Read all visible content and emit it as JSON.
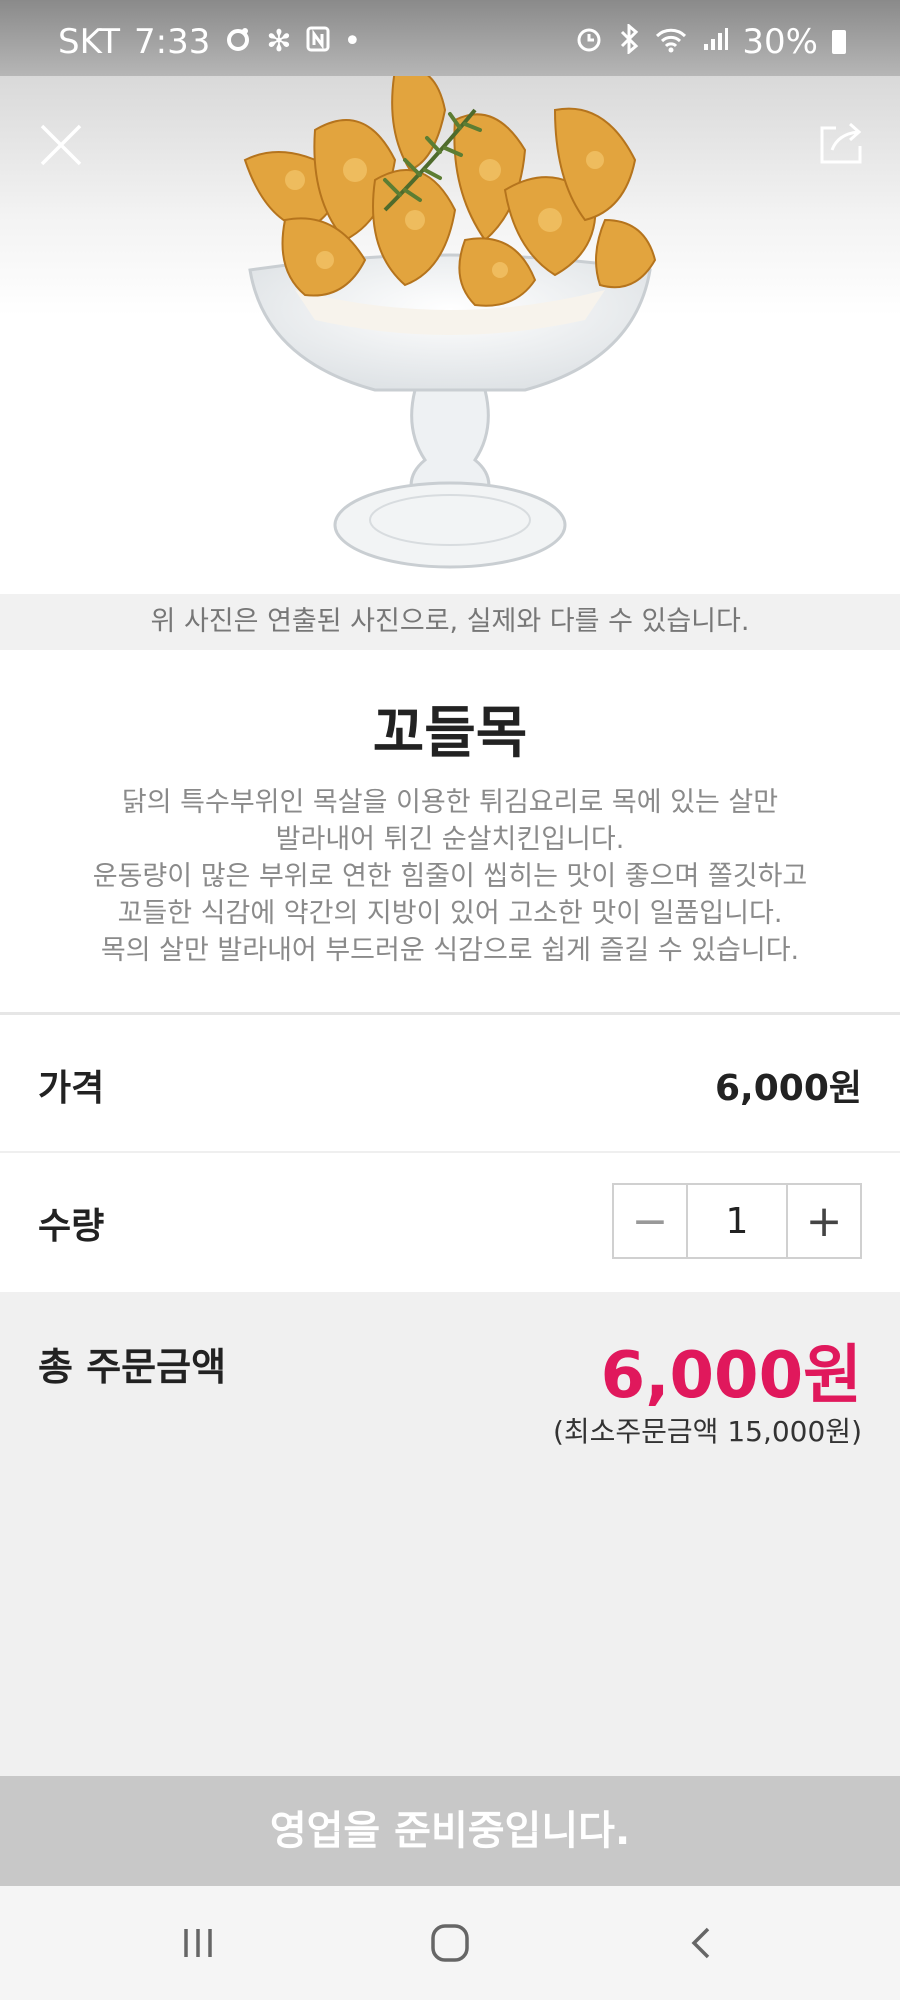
{
  "status_bar": {
    "carrier": "SKT",
    "time": "7:33",
    "battery": "30%",
    "icons_left": [
      "sync-icon",
      "fan-icon",
      "nfc-icon",
      "dot-icon"
    ],
    "icons_right": [
      "alarm-icon",
      "bluetooth-icon",
      "wifi-icon",
      "signal-icon",
      "battery-icon"
    ]
  },
  "header": {
    "close_icon": "close-icon",
    "share_icon": "share-icon"
  },
  "photo_disclaimer": "위 사진은 연출된 사진으로, 실제와 다를 수 있습니다.",
  "product": {
    "name": "꼬들목",
    "description_lines": [
      "닭의 특수부위인 목살을 이용한 튀김요리로 목에 있는 살만",
      "발라내어 튀긴 순살치킨입니다.",
      "운동량이 많은 부위로 연한 힘줄이 씹히는 맛이 좋으며 쫄깃하고",
      "꼬들한 식감에 약간의 지방이 있어 고소한 맛이 일품입니다.",
      "목의 살만 발라내어 부드러운 식감으로 쉽게 즐길 수 있습니다."
    ]
  },
  "price": {
    "label": "가격",
    "value": "6,000원"
  },
  "quantity": {
    "label": "수량",
    "value": "1",
    "minus": "−",
    "plus": "+"
  },
  "total": {
    "label": "총 주문금액",
    "value": "6,000원",
    "min_order": "(최소주문금액 15,000원)",
    "accent_color": "#e0185c"
  },
  "order_button": {
    "label": "영업을 준비중입니다.",
    "disabled": true
  },
  "nav_bar": {
    "icons": [
      "recent-apps-icon",
      "home-icon",
      "back-icon"
    ]
  }
}
